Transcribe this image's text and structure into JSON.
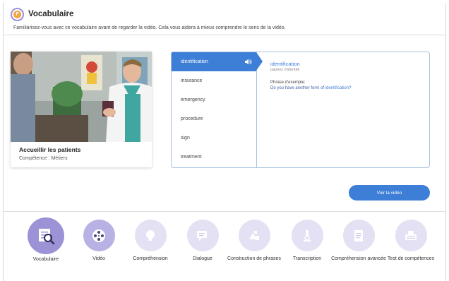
{
  "header": {
    "title": "Vocabulaire",
    "subtitle": "Familiarisez-vous avec ce vocabulaire avant de regarder la vidéo. Cela vous aidera à mieux comprendre le sens de la vidéo."
  },
  "video_card": {
    "title": "Accueillir les patients",
    "competence": "Compétence : Métiers"
  },
  "vocab": {
    "words": [
      {
        "label": "identification"
      },
      {
        "label": "insurance"
      },
      {
        "label": "emergency"
      },
      {
        "label": "procedure"
      },
      {
        "label": "sign"
      },
      {
        "label": "treatment"
      }
    ],
    "selected": {
      "word": "identification",
      "translation": "papiers d'identité",
      "phrase_label": "Phrase d'exemple:",
      "phrase_before": "Do you have another form of ",
      "phrase_highlight": "identification",
      "phrase_after": "?"
    }
  },
  "watch_button": "Voir la vidéo",
  "nav": [
    {
      "label": "Vocabulaire",
      "icon": "vocabulary-icon"
    },
    {
      "label": "Vidéo",
      "icon": "film-reel-icon"
    },
    {
      "label": "Compréhension",
      "icon": "lightbulb-icon"
    },
    {
      "label": "Dialogue",
      "icon": "chat-bubbles-icon"
    },
    {
      "label": "Construction de phrases",
      "icon": "blocks-icon"
    },
    {
      "label": "Transcription",
      "icon": "microscope-icon"
    },
    {
      "label": "Compréhension avancée",
      "icon": "document-icon"
    },
    {
      "label": "Test de compétences",
      "icon": "typewriter-icon"
    }
  ],
  "colors": {
    "accent": "#3d7fd6",
    "nav_active": "#9b93d6",
    "nav_inactive": "#e3e1f3",
    "logo": "#f2a540"
  }
}
